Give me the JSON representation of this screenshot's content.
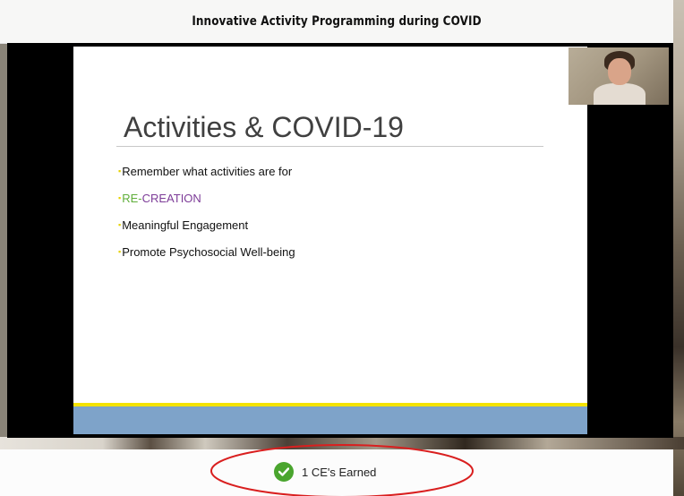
{
  "header": {
    "title": "Innovative Activity Programming during COVID"
  },
  "slide": {
    "title": "Activities & COVID-19",
    "bullets": [
      {
        "text": "Remember what activities are for"
      },
      {
        "re": "RE-",
        "creation": "CREATION"
      },
      {
        "text": "Meaningful Engagement"
      },
      {
        "text": "Promote Psychosocial Well-being"
      }
    ],
    "bullet_glyph": "▪",
    "colors": {
      "bullet": "#e6d200",
      "re": "#5fae3a",
      "creation": "#7d3c98",
      "footer_yellow": "#f4e300",
      "footer_blue": "#7ea3c9"
    }
  },
  "footer": {
    "ce_label": "1 CE's Earned",
    "icon": "check-circle-icon",
    "accent": "#4aa52e",
    "highlight_color": "#d91f1f"
  }
}
